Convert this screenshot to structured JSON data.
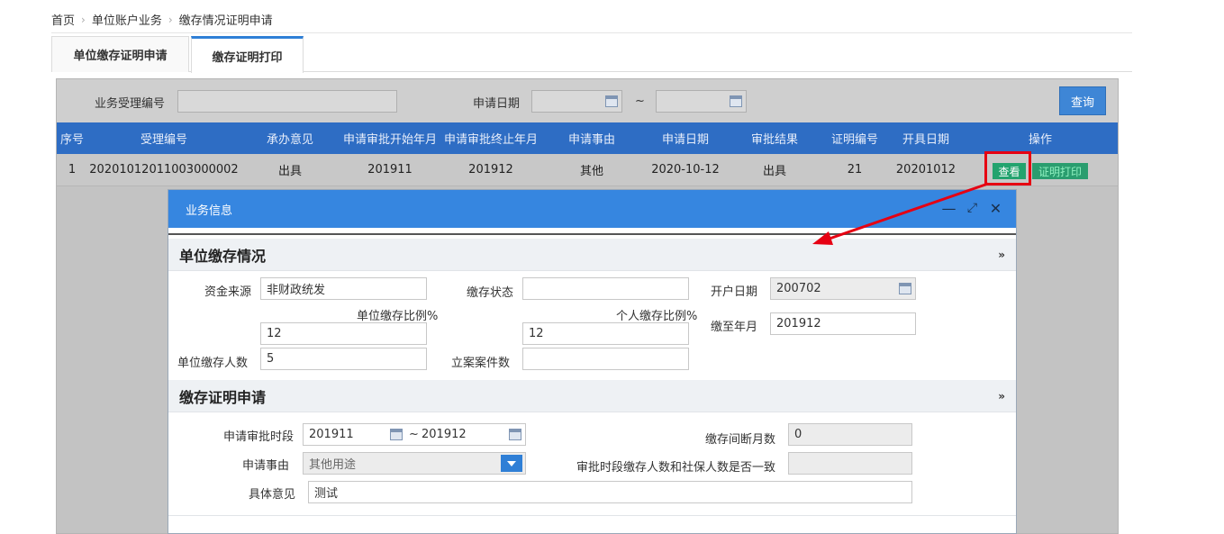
{
  "breadcrumb": [
    "首页",
    "单位账户业务",
    "缴存情况证明申请"
  ],
  "tabs": [
    {
      "label": "单位缴存证明申请",
      "active": false
    },
    {
      "label": "缴存证明打印",
      "active": true
    }
  ],
  "search": {
    "business_no_label": "业务受理编号",
    "business_no_value": "",
    "apply_date_label": "申请日期",
    "date_from": "",
    "date_sep": "~",
    "date_to": "",
    "query_button": "查询"
  },
  "table": {
    "headers": [
      "序号",
      "受理编号",
      "承办意见",
      "申请审批开始年月",
      "申请审批终止年月",
      "申请事由",
      "申请日期",
      "审批结果",
      "证明编号",
      "开具日期",
      "操作"
    ],
    "rows": [
      [
        "1",
        "20201012011003000002",
        "出具",
        "201911",
        "201912",
        "其他",
        "2020-10-12",
        "出具",
        "21",
        "20201012"
      ]
    ],
    "actions": [
      "查看",
      "证明打印"
    ]
  },
  "modal": {
    "title": "业务信息",
    "section1": {
      "title": "单位缴存情况",
      "fund_source_label": "资金来源",
      "fund_source_value": "非财政统发",
      "deposit_status_label": "缴存状态",
      "deposit_status_value": "",
      "open_date_label": "开户日期",
      "open_date_value": "200702",
      "unit_ratio_label": "单位缴存比例%",
      "unit_ratio_value": "12",
      "personal_ratio_label": "个人缴存比例%",
      "personal_ratio_value": "12",
      "paid_until_label": "缴至年月",
      "paid_until_value": "201912",
      "unit_count_label": "单位缴存人数",
      "unit_count_value": "5",
      "case_count_label": "立案案件数",
      "case_count_value": ""
    },
    "section2": {
      "title": "缴存证明申请",
      "period_label": "申请审批时段",
      "period_from": "201911",
      "period_sep": "~",
      "period_to": "201912",
      "gap_months_label": "缴存间断月数",
      "gap_months_value": "0",
      "reason_label": "申请事由",
      "reason_value": "其他用途",
      "consistent_label": "审批时段缴存人数和社保人数是否一致",
      "consistent_value": "",
      "opinion_label": "具体意见",
      "opinion_value": "测试"
    }
  },
  "colors": {
    "accent": "#2e6dc4",
    "modal_header": "#3686e0",
    "annotation": "#e60012",
    "action_green": "#23a36e"
  }
}
